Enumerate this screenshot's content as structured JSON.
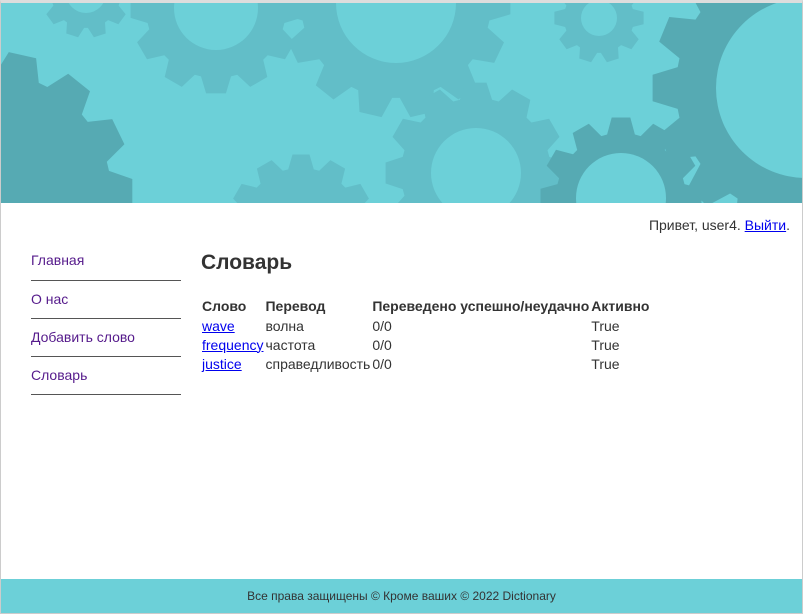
{
  "colors": {
    "banner": "#6cd0d8",
    "gear_dark": "#56aab3",
    "gear_light": "#62bec8",
    "link": "#0000ee",
    "visited": "#551a8b"
  },
  "header": {
    "greeting_prefix": "Привет, user4. ",
    "logout_label": "Выйти",
    "greeting_suffix": "."
  },
  "sidebar": {
    "items": [
      {
        "label": "Главная"
      },
      {
        "label": "О нас"
      },
      {
        "label": "Добавить слово"
      },
      {
        "label": "Словарь"
      }
    ]
  },
  "main": {
    "title": "Словарь",
    "table": {
      "headers": [
        "Слово",
        "Перевод",
        "Переведено успешно/неудачно",
        "Активно"
      ],
      "rows": [
        {
          "word": "wave",
          "translation": "волна",
          "stats": "0/0",
          "active": "True"
        },
        {
          "word": "frequency",
          "translation": "частота",
          "stats": "0/0",
          "active": "True"
        },
        {
          "word": "justice",
          "translation": "справедливость",
          "stats": "0/0",
          "active": "True"
        }
      ]
    }
  },
  "footer": {
    "text": "Все права защищены © Кроме ваших © 2022 Dictionary"
  }
}
